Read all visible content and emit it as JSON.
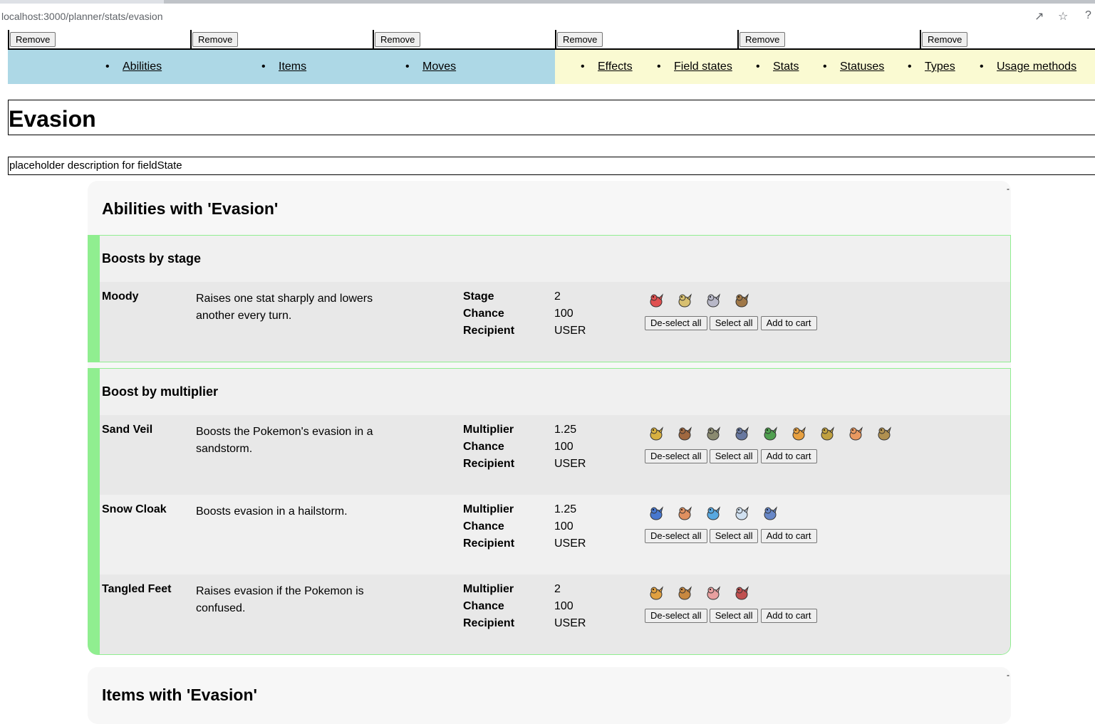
{
  "browser": {
    "url": "localhost:3000/planner/stats/evasion",
    "share_icon": "share-icon",
    "star_icon": "star-icon"
  },
  "remove_buttons": [
    "Remove",
    "Remove",
    "Remove",
    "Remove",
    "Remove",
    "Remove"
  ],
  "nav": {
    "left": [
      "Abilities",
      "Items",
      "Moves"
    ],
    "right": [
      "Effects",
      "Field states",
      "Stats",
      "Statuses",
      "Types",
      "Usage methods"
    ],
    "colors": {
      "left_bg": "#add8e6",
      "right_bg": "#fafad2"
    }
  },
  "page": {
    "title": "Evasion",
    "description": "placeholder description for fieldState"
  },
  "abilities_section": {
    "heading": "Abilities with 'Evasion'",
    "collapse_marker": "-",
    "groups": [
      {
        "title": "Boosts by stage",
        "entries": [
          {
            "name": "Moody",
            "description": "Raises one stat sharply and lowers another every turn.",
            "stats": [
              {
                "label": "Stage",
                "value": "2"
              },
              {
                "label": "Chance",
                "value": "100"
              },
              {
                "label": "Recipient",
                "value": "USER"
              }
            ],
            "sprites": [
              "#e05050",
              "#d8c070",
              "#b8b8c8",
              "#a07848"
            ],
            "buttons": [
              "De-select all",
              "Select all",
              "Add to cart"
            ]
          }
        ]
      },
      {
        "title": "Boost by multiplier",
        "entries": [
          {
            "name": "Sand Veil",
            "description": "Boosts the Pokemon's evasion in a sandstorm.",
            "stats": [
              {
                "label": "Multiplier",
                "value": "1.25"
              },
              {
                "label": "Chance",
                "value": "100"
              },
              {
                "label": "Recipient",
                "value": "USER"
              }
            ],
            "sprites": [
              "#d8b040",
              "#a06840",
              "#8a8a70",
              "#6878a0",
              "#50a050",
              "#e8a040",
              "#c0a040",
              "#e89860",
              "#b09050"
            ],
            "buttons": [
              "De-select all",
              "Select all",
              "Add to cart"
            ]
          },
          {
            "name": "Snow Cloak",
            "description": "Boosts evasion in a hailstorm.",
            "stats": [
              {
                "label": "Multiplier",
                "value": "1.25"
              },
              {
                "label": "Chance",
                "value": "100"
              },
              {
                "label": "Recipient",
                "value": "USER"
              }
            ],
            "sprites": [
              "#4878d0",
              "#e09060",
              "#58a8e0",
              "#d0e0f0",
              "#6888c8"
            ],
            "buttons": [
              "De-select all",
              "Select all",
              "Add to cart"
            ]
          },
          {
            "name": "Tangled Feet",
            "description": "Raises evasion if the Pokemon is confused.",
            "stats": [
              {
                "label": "Multiplier",
                "value": "2"
              },
              {
                "label": "Chance",
                "value": "100"
              },
              {
                "label": "Recipient",
                "value": "USER"
              }
            ],
            "sprites": [
              "#e0a040",
              "#c88840",
              "#e8a0a0",
              "#c05050"
            ],
            "buttons": [
              "De-select all",
              "Select all",
              "Add to cart"
            ]
          }
        ]
      }
    ]
  },
  "items_section": {
    "heading": "Items with 'Evasion'",
    "collapse_marker": "-"
  }
}
